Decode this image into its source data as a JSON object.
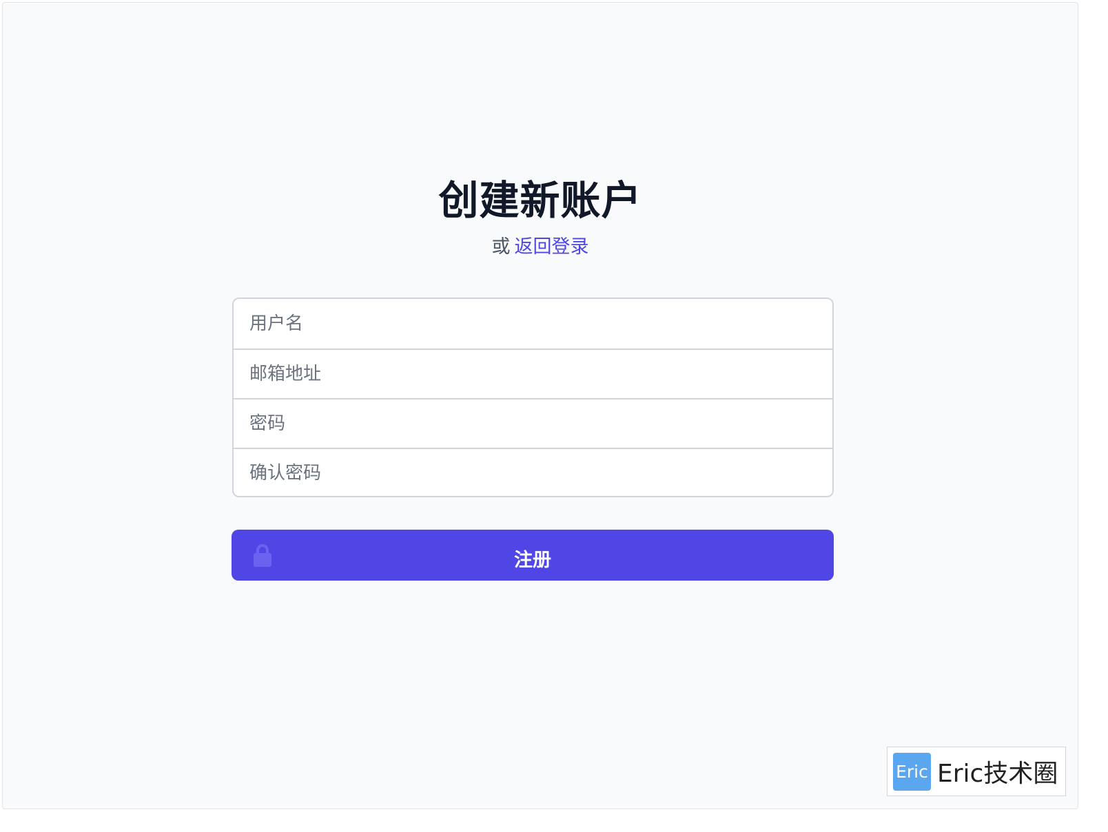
{
  "header": {
    "title": "创建新账户",
    "subtitle_prefix": "或",
    "login_link": "返回登录"
  },
  "form": {
    "username_placeholder": "用户名",
    "email_placeholder": "邮箱地址",
    "password_placeholder": "密码",
    "confirm_password_placeholder": "确认密码",
    "submit_label": "注册"
  },
  "watermark": {
    "logo_text": "Eric",
    "text": "Eric技术圈"
  },
  "colors": {
    "accent": "#4f46e5",
    "background": "#f9fafb",
    "heading": "#111827",
    "watermark_logo": "#5aa6ef"
  },
  "icons": {
    "submit_icon": "lock-icon"
  }
}
